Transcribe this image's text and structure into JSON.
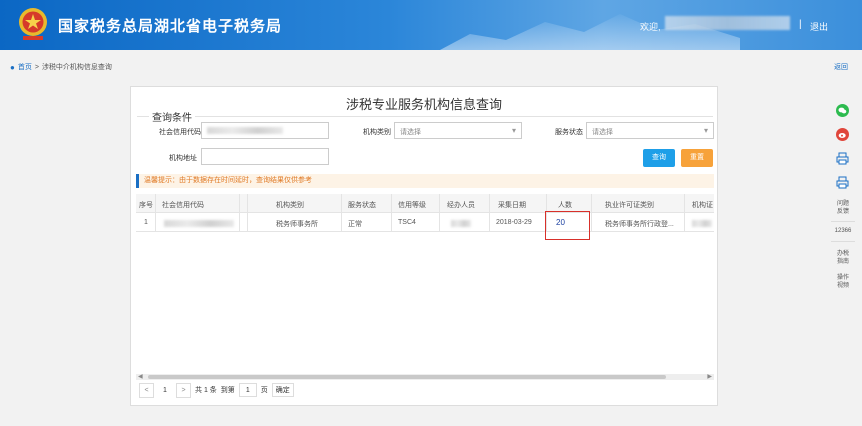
{
  "header": {
    "site_title": "国家税务总局湖北省电子税务局",
    "welcome": "欢迎,",
    "separator": "|",
    "logout": "退出"
  },
  "breadcrumb": {
    "home": "首页",
    "sep": ">",
    "current": "涉税中介机构信息查询"
  },
  "back": "返回",
  "panel": {
    "title": "涉税专业服务机构信息查询",
    "legend": "查询条件",
    "fields": {
      "credit_code_label": "社会信用代码",
      "type_label": "机构类别",
      "type_placeholder": "请选择",
      "status_label": "服务状态",
      "status_placeholder": "请选择",
      "address_label": "机构地址"
    },
    "buttons": {
      "query": "查询",
      "reset": "重置"
    },
    "tip": "温馨提示：由于数据存在时间延时，查询结果仅供参考"
  },
  "table": {
    "headers": [
      "序号",
      "社会信用代码",
      "机构类别",
      "服务状态",
      "信用等级",
      "经办人员",
      "采集日期",
      "人数",
      "执业许可证类别",
      "机构证"
    ],
    "rows": [
      {
        "index": "1",
        "type": "税务师事务所",
        "status": "正常",
        "credit_level": "TSC4",
        "date": "2018-03-29",
        "count": "20",
        "license": "税务师事务所行政登..."
      }
    ]
  },
  "pager": {
    "prev": "<",
    "page": "1",
    "next": ">",
    "total": "共 1 条",
    "goto": "到第",
    "goto_value": "1",
    "page_unit": "页",
    "confirm": "确定"
  },
  "sidebar": {
    "feedback": "问题\n反馈",
    "hotline": "12366",
    "guide": "办税\n指南",
    "manual": "操作\n视频"
  },
  "colors": {
    "header_blue": "#0b67c4",
    "query_btn": "#1e9fe8",
    "reset_btn": "#f7a23a",
    "highlight": "#d8302a",
    "wechat": "#2dbb4f",
    "weibo": "#e0463b",
    "print": "#1a6fc4"
  }
}
